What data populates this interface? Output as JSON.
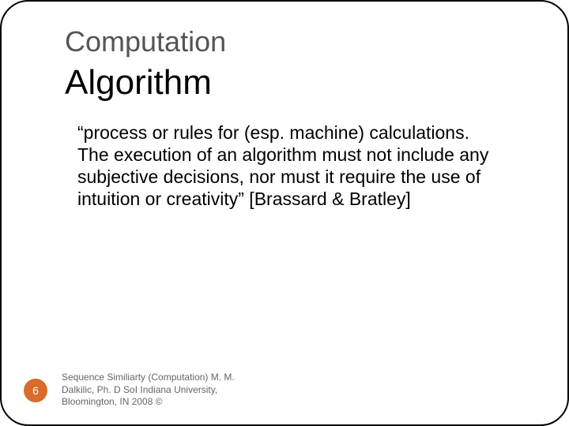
{
  "title": "Computation",
  "subtitle": "Algorithm",
  "body": "“process or rules for (esp. machine) calculations. The execution of an algorithm must not include any subjective decisions, nor must it require the use of intuition or creativity” [Brassard & Bratley]",
  "page_number": "6",
  "footer": "Sequence Similiarty (Computation) M. M. Dalkilic, Ph. D SoI Indiana University, Bloomington, IN 2008 ©"
}
